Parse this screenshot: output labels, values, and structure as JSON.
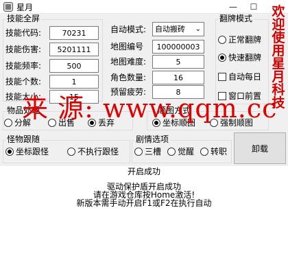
{
  "window": {
    "title": "星月",
    "minimize": "—",
    "maximize": "☐",
    "close": "✕"
  },
  "skill_group": {
    "legend": "技能全屏",
    "fields": [
      {
        "label": "技能代码:",
        "value": "70231"
      },
      {
        "label": "技能伤害:",
        "value": "5201111"
      },
      {
        "label": "技能频率:",
        "value": "500"
      },
      {
        "label": "技能个数:",
        "value": "1"
      },
      {
        "label": "技能大小:",
        "value": "15"
      }
    ]
  },
  "settings": {
    "auto_mode": {
      "label": "自动模式:",
      "value": "自动搬砖"
    },
    "map_id": {
      "label": "地图编号",
      "value": "100000003"
    },
    "map_difficulty": {
      "label": "地图难度:",
      "value": "5"
    },
    "role_count": {
      "label": "角色数量:",
      "value": "16"
    },
    "reserve_fatigue": {
      "label": "预留疲劳:",
      "value": "8"
    }
  },
  "flip_mode": {
    "legend": "翻牌模式",
    "options": [
      {
        "label": "正常翻牌",
        "checked": false
      },
      {
        "label": "快速翻牌",
        "checked": true
      }
    ],
    "checkboxes": [
      {
        "label": "自动每日",
        "checked": false
      },
      {
        "label": "窗口前置",
        "checked": false
      }
    ]
  },
  "item_handling": {
    "legend": "物品处理",
    "options": [
      {
        "label": "分解",
        "checked": false
      },
      {
        "label": "出售",
        "checked": false
      },
      {
        "label": "丢弃",
        "checked": true
      }
    ]
  },
  "map_method": {
    "legend": "顺图方式",
    "options": [
      {
        "label": "坐标顺图",
        "checked": true
      },
      {
        "label": "强制顺图",
        "checked": false
      }
    ]
  },
  "monster_follow": {
    "legend": "怪物跟随",
    "options": [
      {
        "label": "坐标跟怪",
        "checked": true
      },
      {
        "label": "不执行跟怪",
        "checked": false
      }
    ]
  },
  "story_options": {
    "legend": "剧情选项",
    "options": [
      {
        "label": "三槽",
        "checked": false
      },
      {
        "label": "觉醒",
        "checked": false
      },
      {
        "label": "转职",
        "checked": false
      }
    ]
  },
  "unload_button": "卸载",
  "log": [
    "开启成功",
    "驱动保护盾开启成功",
    "请在游戏仓库按Home激活!",
    "新版本需手动开启F1或F2在执行自动"
  ],
  "overlay": {
    "side_text": "欢迎使用星月科技",
    "watermark": "来 源: www.qqm.cc"
  },
  "colors": {
    "watermark": "#e00000",
    "panel": "#f0f0f0",
    "log_bg": "#ffffff"
  }
}
